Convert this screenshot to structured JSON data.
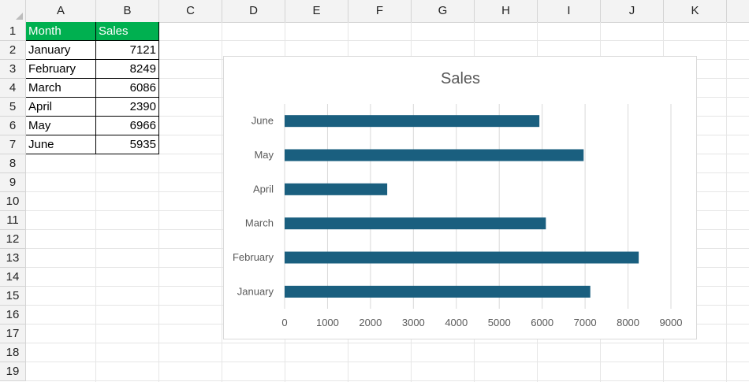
{
  "sheet": {
    "columns": [
      "A",
      "B",
      "C",
      "D",
      "E",
      "F",
      "G",
      "H",
      "I",
      "J",
      "K"
    ],
    "rows": [
      "1",
      "2",
      "3",
      "4",
      "5",
      "6",
      "7",
      "8",
      "9",
      "10",
      "11",
      "12",
      "13",
      "14",
      "15",
      "16",
      "17",
      "18",
      "19"
    ],
    "table": {
      "headers": [
        "Month",
        "Sales"
      ],
      "rows": [
        [
          "January",
          "7121"
        ],
        [
          "February",
          "8249"
        ],
        [
          "March",
          "6086"
        ],
        [
          "April",
          "2390"
        ],
        [
          "May",
          "6966"
        ],
        [
          "June",
          "5935"
        ]
      ]
    }
  },
  "chart_data": {
    "type": "bar",
    "orientation": "horizontal",
    "title": "Sales",
    "categories": [
      "January",
      "February",
      "March",
      "April",
      "May",
      "June"
    ],
    "values": [
      7121,
      8249,
      6086,
      2390,
      6966,
      5935
    ],
    "xlim": [
      0,
      9000
    ],
    "xticks": [
      "0",
      "1000",
      "2000",
      "3000",
      "4000",
      "5000",
      "6000",
      "7000",
      "8000",
      "9000"
    ],
    "bar_color": "#1a5f7f",
    "grid": true,
    "legend": false
  }
}
